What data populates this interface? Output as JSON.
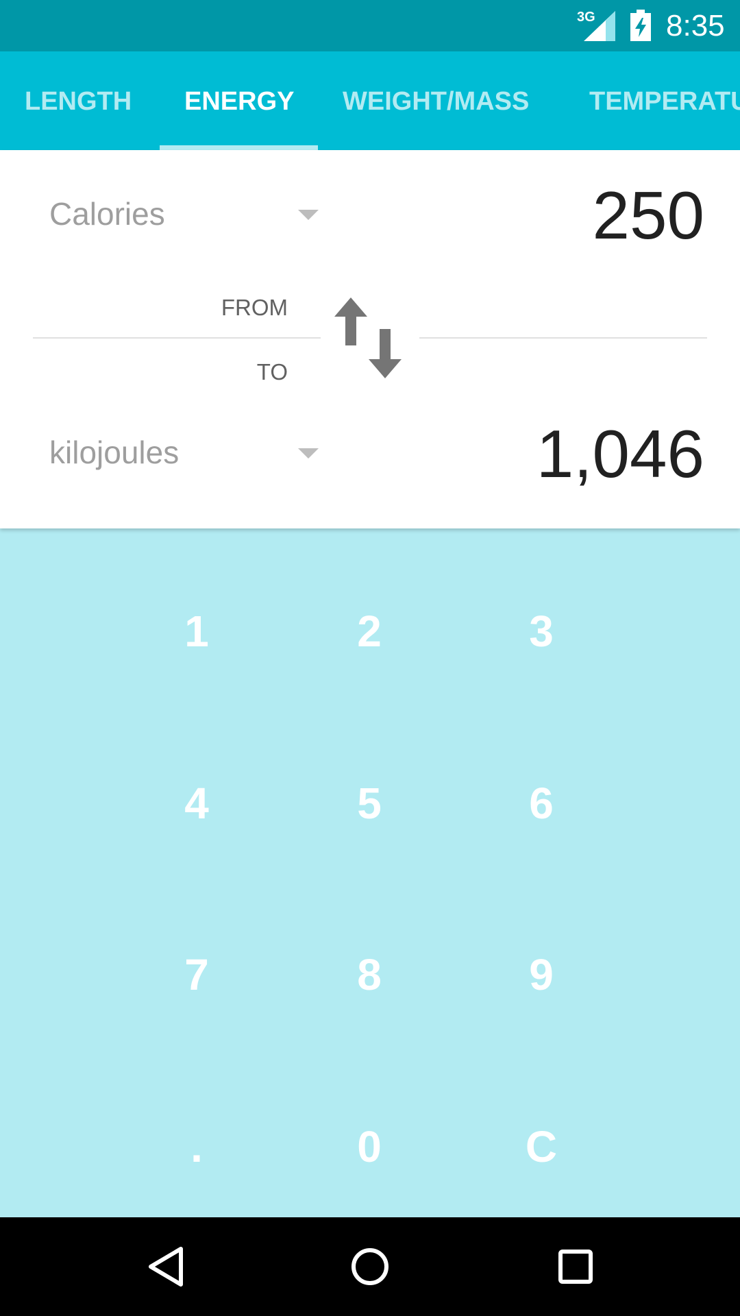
{
  "status_bar": {
    "network": "3G",
    "time": "8:35"
  },
  "tabs": [
    {
      "label": "LENGTH",
      "active": false
    },
    {
      "label": "ENERGY",
      "active": true
    },
    {
      "label": "WEIGHT/MASS",
      "active": false
    },
    {
      "label": "TEMPERATU",
      "active": false
    }
  ],
  "converter": {
    "from_unit": "Calories",
    "from_value": "250",
    "from_label": "FROM",
    "to_label": "TO",
    "to_unit": "kilojoules",
    "to_value": "1,046"
  },
  "keypad": {
    "keys": [
      "1",
      "2",
      "3",
      "4",
      "5",
      "6",
      "7",
      "8",
      "9",
      ".",
      "0",
      "C"
    ]
  },
  "icons": {
    "swap": "swap-vertical-icon",
    "dropdown": "triangle-down-icon",
    "back": "back-icon",
    "home": "home-icon",
    "recents": "recents-icon"
  },
  "colors": {
    "status_bar": "#0097a7",
    "tab_bar": "#00bcd4",
    "keypad_bg": "#b2ebf2",
    "tab_inactive": "#b2ebf2",
    "tab_active": "#ffffff"
  }
}
